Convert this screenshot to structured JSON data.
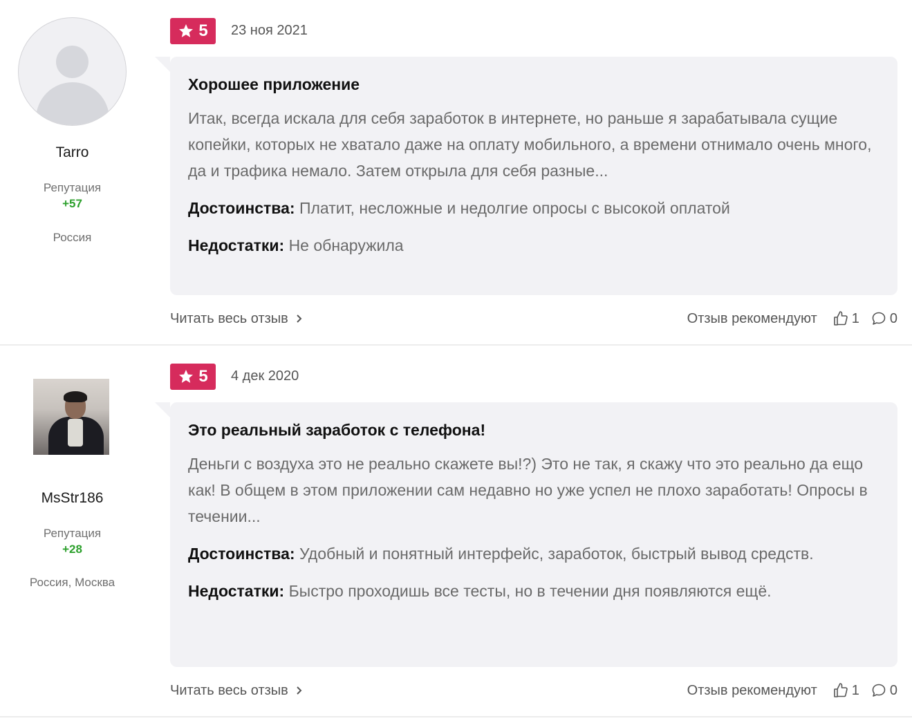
{
  "reviews": [
    {
      "author": {
        "name": "Tarro",
        "reputation_label": "Репутация",
        "reputation": "+57",
        "location": "Россия"
      },
      "rating": "5",
      "date": "23 ноя 2021",
      "title": "Хорошее приложение",
      "text": "Итак, всегда искала для себя заработок в интернете, но раньше я зарабатывала сущие копейки, которых не хватало даже на оплату мобильного, а времени отнимало очень много, да и трафика немало. Затем открыла для себя разные...",
      "pros_label": "Достоинства:",
      "pros": "Платит, несложные и недолгие опросы с высокой оплатой",
      "cons_label": "Недостатки:",
      "cons": "Не обнаружила",
      "read_more": "Читать весь отзыв",
      "recommend_label": "Отзыв рекомендуют",
      "likes": "1",
      "comments": "0"
    },
    {
      "author": {
        "name": "MsStr186",
        "reputation_label": "Репутация",
        "reputation": "+28",
        "location": "Россия, Москва"
      },
      "rating": "5",
      "date": "4 дек 2020",
      "title": "Это реальный заработок с телефона!",
      "text": "Деньги с воздуха это не реально скажете вы!?) Это не так, я скажу что это реально да ещо как! В общем в этом приложении сам недавно но уже успел не плохо заработать! Опросы в течении...",
      "pros_label": "Достоинства:",
      "pros": "Удобный и понятный интерфейс, заработок, быстрый вывод средств.",
      "cons_label": "Недостатки:",
      "cons": "Быстро проходишь все тесты, но в течении дня появляются ещё.",
      "read_more": "Читать весь отзыв",
      "recommend_label": "Отзыв рекомендуют",
      "likes": "1",
      "comments": "0"
    }
  ],
  "colors": {
    "rating_badge": "#d62b5c",
    "reputation": "#2ca02c",
    "bubble": "#f2f2f5"
  },
  "icons": [
    "star-icon",
    "chevron-right-icon",
    "thumbs-up-icon",
    "comment-icon",
    "user-placeholder-icon"
  ]
}
